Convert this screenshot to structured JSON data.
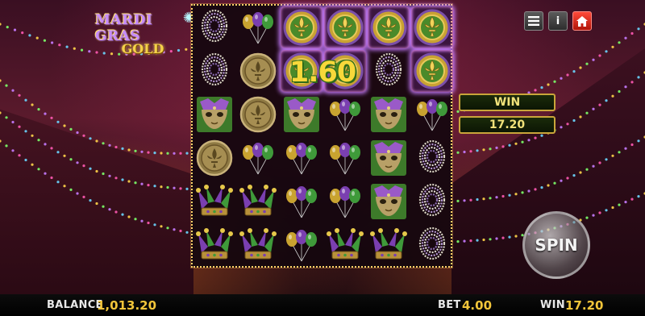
{
  "game": {
    "logo_line1": "MARDI GRAS",
    "logo_line2": "GOLD",
    "win_amount_overlay": "1.60"
  },
  "toolbar": {
    "menu_icon": "menu-icon",
    "info_label": "i",
    "home_icon": "home-icon"
  },
  "win_panel": {
    "label": "WIN",
    "value": "17.20"
  },
  "spin": {
    "label": "SPIN"
  },
  "bottom": {
    "balance_label": "BALANCE",
    "balance_value": "1,013.20",
    "bet_label": "BET",
    "bet_value": "4.00",
    "win_label": "WIN",
    "win_value": "17.20"
  },
  "reels": {
    "rows": [
      [
        "beads",
        "balloons",
        "coin-fleur",
        "coin-fleur",
        "coin-fleur",
        "coin-fleur"
      ],
      [
        "beads",
        "coin-bronze",
        "coin-fleur",
        "coin-fleur",
        "beads",
        "coin-fleur"
      ],
      [
        "mask",
        "coin-bronze",
        "mask",
        "balloons",
        "mask",
        "balloons"
      ],
      [
        "coin-bronze",
        "balloons",
        "balloons",
        "balloons",
        "mask",
        "beads"
      ],
      [
        "jester-hat",
        "jester-hat",
        "balloons",
        "balloons",
        "mask",
        "beads"
      ],
      [
        "jester-hat",
        "jester-hat",
        "balloons",
        "jester-hat",
        "jester-hat",
        "beads"
      ]
    ],
    "highlighted": [
      [
        0,
        2
      ],
      [
        0,
        3
      ],
      [
        0,
        4
      ],
      [
        0,
        5
      ],
      [
        1,
        2
      ],
      [
        1,
        3
      ],
      [
        1,
        5
      ]
    ]
  }
}
